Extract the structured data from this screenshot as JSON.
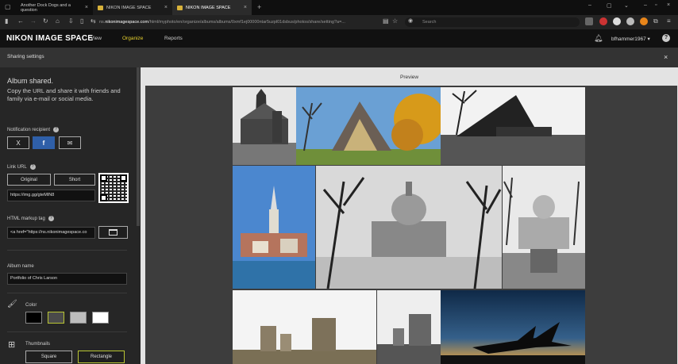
{
  "browser": {
    "tabs": [
      {
        "title": "Another Dock Dogs and a question"
      },
      {
        "title": "NIKON IMAGE SPACE"
      },
      {
        "title": "NIKON IMAGE SPACE"
      }
    ],
    "url_prefix": "ns.",
    "url_domain": "nikonimagespace.com",
    "url_rest": "/html/myphoto/en/organize/albums/albums/0xmf1ej00000ntar5uzpl01dsbus/photos/share/setting?a=...",
    "search_placeholder": "Search"
  },
  "app": {
    "logo": "NIKON IMAGE SPACE",
    "menu": [
      "View",
      "Organize",
      "Reports"
    ],
    "active_menu": "Organize",
    "user": "bfhammer1967 ▾",
    "help": "?"
  },
  "share_header": {
    "title": "Sharing settings",
    "close": "×"
  },
  "sidebar": {
    "heading": "Album shared.",
    "description": "Copy the URL and share it with friends and family via e-mail or social media.",
    "notification_label": "Notification recipient",
    "social": {
      "x": "X",
      "facebook": "f",
      "mail": "✉"
    },
    "link_url_label": "Link URL",
    "link_original": "Original",
    "link_short": "Short",
    "link_value": "https://img.gg/gteMIN8",
    "html_label": "HTML markup tag",
    "html_value": "<a href=\"https://ns.nikonimagespace.co",
    "album_name_label": "Album name",
    "album_name_value": "Portfolio of Chris Larson",
    "color_label": "Color",
    "colors": [
      "#000000",
      "#4a4a4a",
      "#bdbdbd",
      "#ffffff"
    ],
    "thumbnails_label": "Thumbnails",
    "thumb_square": "Square",
    "thumb_rectangle": "Rectangle",
    "help": "?"
  },
  "preview": {
    "label": "Preview"
  }
}
